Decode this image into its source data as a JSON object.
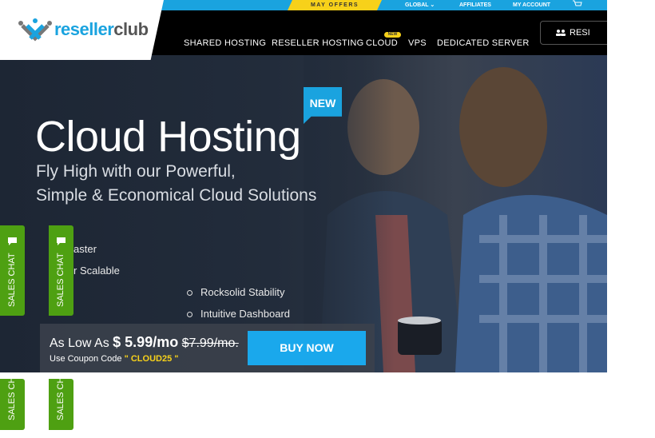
{
  "topbar": {
    "offers": "MAY OFFERS",
    "global": "GLOBAL",
    "affiliates": "AFFILIATES",
    "my_account": "MY ACCOUNT",
    "cart_icon": "cart-icon"
  },
  "brand": {
    "name_part1": "reseller",
    "name_part2": "club",
    "primary_color": "#1aa3df",
    "accent_color": "#f7d11a",
    "chat_color": "#4ea012"
  },
  "nav": {
    "items": [
      {
        "label": "SHARED HOSTING"
      },
      {
        "label": "RESELLER HOSTING"
      },
      {
        "label": "CLOUD",
        "badge": "NEW"
      },
      {
        "label": "VPS"
      },
      {
        "label": "DEDICATED SERVER"
      }
    ],
    "reseller_button": "RESI"
  },
  "hero": {
    "tag": "NEW",
    "title": "Cloud Hosting",
    "subtitle_line1": "Fly High with our Powerful,",
    "subtitle_line2": "Simple & Economical Cloud Solutions",
    "features_left": [
      "aster",
      "r Scalable"
    ],
    "features_right": [
      "Rocksolid Stability",
      "Intuitive Dashboard"
    ]
  },
  "pricing": {
    "prefix": "As Low As",
    "price": "$ 5.99/mo",
    "old_price": "$7.99/mo.",
    "coupon_prefix": "Use Coupon Code",
    "coupon_code": "\" CLOUD25 \"",
    "buy_label": "BUY NOW"
  },
  "chat_tabs": [
    {
      "label": "SALES CHAT"
    },
    {
      "label": "SALES CHAT"
    },
    {
      "label": "SALES CH"
    },
    {
      "label": "SALES CH"
    }
  ]
}
